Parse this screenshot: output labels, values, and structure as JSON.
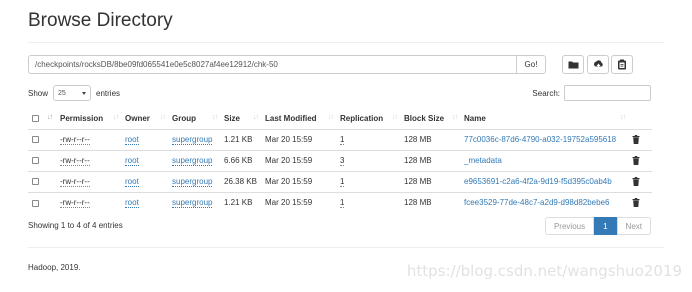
{
  "page": {
    "title": "Browse Directory"
  },
  "path_bar": {
    "value": "/checkpoints/rocksDB/8be09fd065541e0e5c8027af4ee12912/chk-50",
    "go_label": "Go!"
  },
  "toolbar": {
    "icons": [
      "folder-icon",
      "upload-icon",
      "clipboard-icon"
    ]
  },
  "length": {
    "show_label": "Show",
    "selected": "25",
    "entries_label": "entries"
  },
  "search": {
    "label": "Search:"
  },
  "table": {
    "headers": {
      "permission": "Permission",
      "owner": "Owner",
      "group": "Group",
      "size": "Size",
      "last_modified": "Last Modified",
      "replication": "Replication",
      "block_size": "Block Size",
      "name": "Name"
    },
    "rows": [
      {
        "permission": "-rw-r--r--",
        "owner": "root",
        "group": "supergroup",
        "size": "1.21 KB",
        "last_modified": "Mar 20 15:59",
        "replication": "1",
        "block_size": "128 MB",
        "name": "77c0036c-87d6-4790-a032-19752a595618"
      },
      {
        "permission": "-rw-r--r--",
        "owner": "root",
        "group": "supergroup",
        "size": "6.66 KB",
        "last_modified": "Mar 20 15:59",
        "replication": "3",
        "block_size": "128 MB",
        "name": "_metadata"
      },
      {
        "permission": "-rw-r--r--",
        "owner": "root",
        "group": "supergroup",
        "size": "26.38 KB",
        "last_modified": "Mar 20 15:59",
        "replication": "1",
        "block_size": "128 MB",
        "name": "e9653691-c2a6-4f2a-9d19-f5d395c0ab4b"
      },
      {
        "permission": "-rw-r--r--",
        "owner": "root",
        "group": "supergroup",
        "size": "1.21 KB",
        "last_modified": "Mar 20 15:59",
        "replication": "1",
        "block_size": "128 MB",
        "name": "fcee3529-77de-48c7-a2d9-d98d82bebe6"
      }
    ]
  },
  "info": {
    "text": "Showing 1 to 4 of 4 entries"
  },
  "pagination": {
    "previous": "Previous",
    "current": "1",
    "next": "Next"
  },
  "footer": {
    "text": "Hadoop, 2019."
  },
  "watermark": {
    "text": "https://blog.csdn.net/wangshuo2019"
  },
  "colors": {
    "link": "#337ab7",
    "active_page": "#337ab7"
  }
}
